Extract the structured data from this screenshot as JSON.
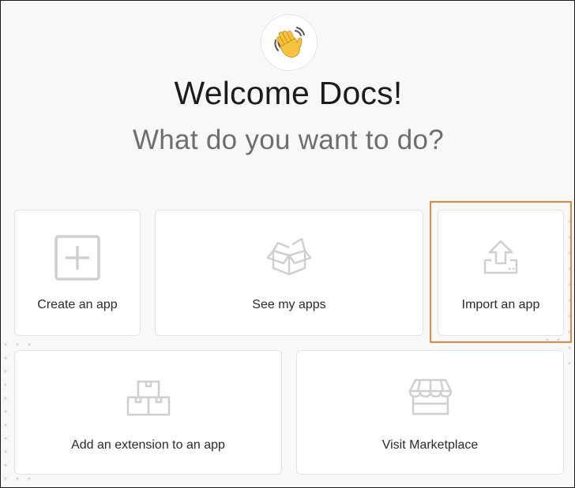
{
  "header": {
    "greeting": "Welcome Docs!",
    "question": "What do you want to do?"
  },
  "actions": [
    {
      "label": "Create an app",
      "icon": "plus-square-icon"
    },
    {
      "label": "See my apps",
      "icon": "open-box-icon"
    },
    {
      "label": "Import an app",
      "icon": "upload-tray-icon"
    },
    {
      "label": "Add an extension to an app",
      "icon": "stacked-boxes-icon"
    },
    {
      "label": "Visit Marketplace",
      "icon": "storefront-icon"
    }
  ],
  "colors": {
    "highlight": "#e8873a",
    "icon_gray": "#cfcfcf"
  }
}
